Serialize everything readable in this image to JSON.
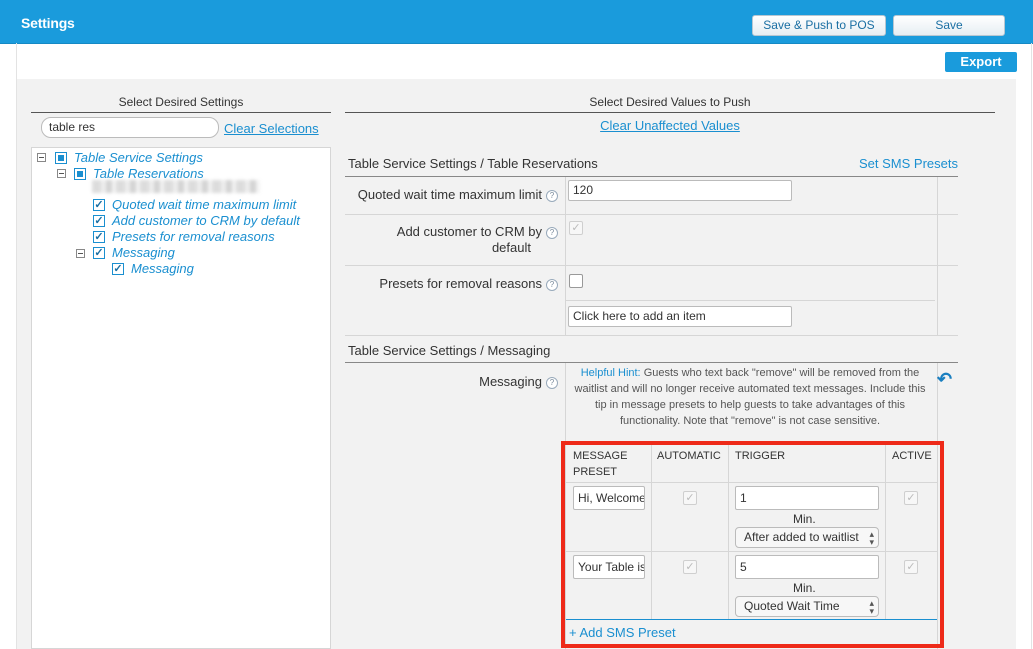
{
  "header": {
    "title": "Settings",
    "save_push_label": "Save & Push to POS",
    "save_label": "Save",
    "export_label": "Export"
  },
  "left": {
    "heading": "Select Desired Settings",
    "search_value": "table res",
    "clear_selections": "Clear Selections",
    "tree": {
      "root": "Table Service Settings",
      "child": "Table Reservations",
      "items": [
        "Quoted wait time maximum limit",
        "Add customer to CRM by default",
        "Presets for removal reasons"
      ],
      "messaging_group": "Messaging",
      "messaging_item": "Messaging"
    }
  },
  "right": {
    "heading": "Select Desired Values to Push",
    "clear_unaffected": "Clear Unaffected Values",
    "section1_title": "Table Service Settings / Table Reservations",
    "set_sms_presets": "Set SMS Presets",
    "quoted_label": "Quoted wait time maximum limit",
    "quoted_value": "120",
    "crm_label_line1": "Add customer to CRM by",
    "crm_label_line2": "default",
    "presets_label": "Presets for removal reasons",
    "add_item_value": "Click here to add an item",
    "section2_title": "Table Service Settings / Messaging",
    "messaging_label": "Messaging",
    "hint_label": "Helpful Hint:",
    "hint_text": "Guests who text back \"remove\" will be removed from the waitlist and will no longer receive automated text messages. Include this tip in message presets to help guests to take advantages of this functionality. Note that \"remove\" is not case sensitive.",
    "table": {
      "col_preset_line1": "MESSAGE",
      "col_preset_line2": "PRESET",
      "col_automatic": "AUTOMATIC",
      "col_trigger": "TRIGGER",
      "col_active": "ACTIVE",
      "rows": [
        {
          "preset": "Hi, Welcome",
          "trigger_value": "1",
          "unit": "Min.",
          "trigger_event": "After added to waitlist"
        },
        {
          "preset": "Your Table is",
          "trigger_value": "5",
          "unit": "Min.",
          "trigger_event": "Quoted Wait Time"
        }
      ],
      "add_label": "+ Add SMS Preset"
    }
  },
  "colors": {
    "header_blue": "#1a9bdc",
    "link_blue": "#1a8fd0",
    "highlight_red": "#ee2a19"
  }
}
